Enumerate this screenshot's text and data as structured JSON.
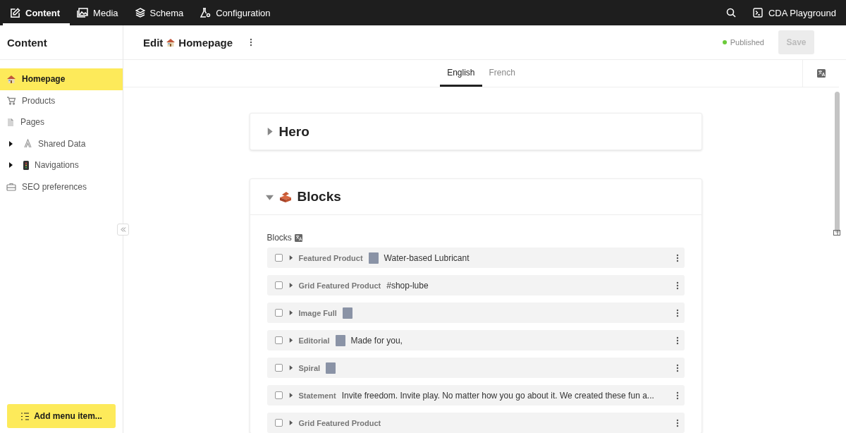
{
  "topbar": {
    "tabs": [
      {
        "label": "Content",
        "selected": true
      },
      {
        "label": "Media",
        "selected": false
      },
      {
        "label": "Schema",
        "selected": false
      },
      {
        "label": "Configuration",
        "selected": false
      }
    ],
    "project": "CDA Playground"
  },
  "sidebar": {
    "title": "Content",
    "items": [
      {
        "label": "Homepage",
        "selected": true,
        "expandable": false
      },
      {
        "label": "Products",
        "selected": false,
        "expandable": false
      },
      {
        "label": "Pages",
        "selected": false,
        "expandable": false
      },
      {
        "label": "Shared Data",
        "selected": false,
        "expandable": true,
        "expanded": false
      },
      {
        "label": "Navigations",
        "selected": false,
        "expandable": true,
        "expanded": false
      },
      {
        "label": "SEO preferences",
        "selected": false,
        "expandable": false
      }
    ],
    "add_button": "Add menu item..."
  },
  "editor": {
    "title_prefix": "Edit",
    "title": "Homepage",
    "status": {
      "label": "Published",
      "color": "#6bcb3b"
    },
    "save": {
      "label": "Save",
      "disabled": true
    }
  },
  "locales": [
    {
      "label": "English",
      "selected": true
    },
    {
      "label": "French",
      "selected": false
    }
  ],
  "sections": [
    {
      "title": "Hero",
      "expanded": false,
      "emoji": false
    },
    {
      "title": "Blocks",
      "expanded": true,
      "emoji": true,
      "field_label": "Blocks",
      "rows": [
        {
          "type": "Featured Product",
          "image": true,
          "summary": "Water-based Lubricant",
          "checked": false
        },
        {
          "type": "Grid Featured Product",
          "image": false,
          "summary": "#shop-lube",
          "checked": false
        },
        {
          "type": "Image Full",
          "image": true,
          "checked": false
        },
        {
          "type": "Editorial",
          "image": true,
          "summary": "Made for you,",
          "checked": false
        },
        {
          "type": "Spiral",
          "image": true,
          "checked": false
        },
        {
          "type": "Statement",
          "image": false,
          "summary": "Invite freedom. Invite play. No matter how you go about it. We created these fun a...",
          "checked": false
        },
        {
          "type": "Grid Featured Product",
          "image": false,
          "checked": false
        }
      ]
    }
  ]
}
